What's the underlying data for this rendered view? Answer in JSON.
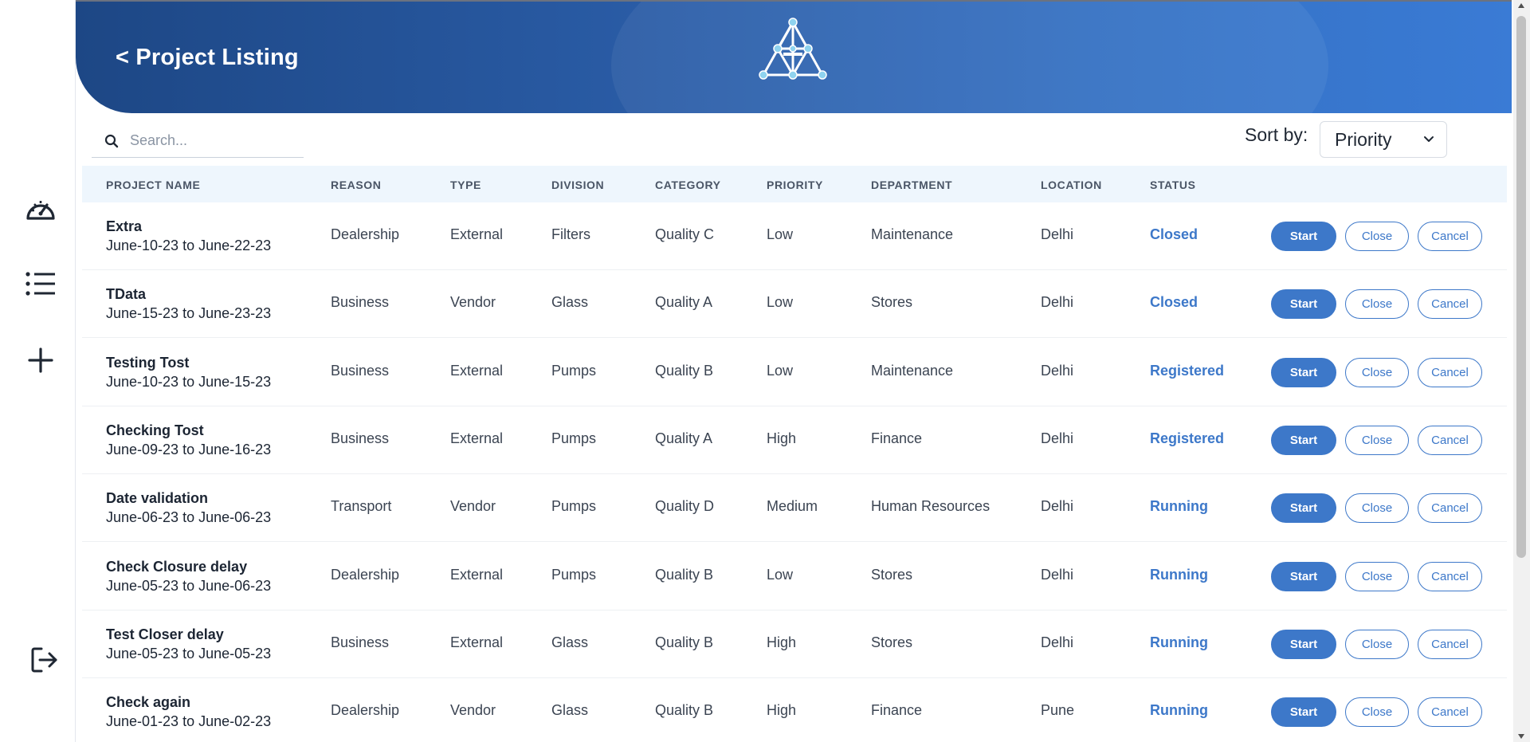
{
  "header": {
    "title": "< Project Listing"
  },
  "sidebar": {
    "items": [
      {
        "icon": "dashboard-gauge-icon"
      },
      {
        "icon": "list-icon"
      },
      {
        "icon": "plus-icon"
      },
      {
        "icon": "logout-icon"
      }
    ]
  },
  "search": {
    "placeholder": "Search..."
  },
  "sort": {
    "label": "Sort by:",
    "selected": "Priority"
  },
  "table": {
    "columns": [
      "PROJECT NAME",
      "REASON",
      "TYPE",
      "DIVISION",
      "CATEGORY",
      "PRIORITY",
      "DEPARTMENT",
      "LOCATION",
      "STATUS"
    ],
    "rows": [
      {
        "name": "Extra",
        "dates": "June-10-23 to June-22-23",
        "reason": "Dealership",
        "type": "External",
        "division": "Filters",
        "category": "Quality C",
        "priority": "Low",
        "department": "Maintenance",
        "location": "Delhi",
        "status": "Closed"
      },
      {
        "name": "TData",
        "dates": "June-15-23 to June-23-23",
        "reason": "Business",
        "type": "Vendor",
        "division": "Glass",
        "category": "Quality A",
        "priority": "Low",
        "department": "Stores",
        "location": "Delhi",
        "status": "Closed"
      },
      {
        "name": "Testing Tost",
        "dates": "June-10-23 to June-15-23",
        "reason": "Business",
        "type": "External",
        "division": "Pumps",
        "category": "Quality B",
        "priority": "Low",
        "department": "Maintenance",
        "location": "Delhi",
        "status": "Registered"
      },
      {
        "name": "Checking Tost",
        "dates": "June-09-23 to June-16-23",
        "reason": "Business",
        "type": "External",
        "division": "Pumps",
        "category": "Quality A",
        "priority": "High",
        "department": "Finance",
        "location": "Delhi",
        "status": "Registered"
      },
      {
        "name": "Date validation",
        "dates": "June-06-23 to June-06-23",
        "reason": "Transport",
        "type": "Vendor",
        "division": "Pumps",
        "category": "Quality D",
        "priority": "Medium",
        "department": "Human Resources",
        "location": "Delhi",
        "status": "Running"
      },
      {
        "name": "Check Closure delay",
        "dates": "June-05-23 to June-06-23",
        "reason": "Dealership",
        "type": "External",
        "division": "Pumps",
        "category": "Quality B",
        "priority": "Low",
        "department": "Stores",
        "location": "Delhi",
        "status": "Running"
      },
      {
        "name": "Test Closer delay",
        "dates": "June-05-23 to June-05-23",
        "reason": "Business",
        "type": "External",
        "division": "Glass",
        "category": "Quality B",
        "priority": "High",
        "department": "Stores",
        "location": "Delhi",
        "status": "Running"
      },
      {
        "name": "Check again",
        "dates": "June-01-23 to June-02-23",
        "reason": "Dealership",
        "type": "Vendor",
        "division": "Glass",
        "category": "Quality B",
        "priority": "High",
        "department": "Finance",
        "location": "Pune",
        "status": "Running"
      }
    ],
    "actions": {
      "start": "Start",
      "close": "Close",
      "cancel": "Cancel"
    }
  },
  "colors": {
    "accent": "#3d78c9",
    "header_dark": "#1d4785",
    "header_light": "#3a7bd5",
    "table_header_bg": "#eef6fd"
  }
}
